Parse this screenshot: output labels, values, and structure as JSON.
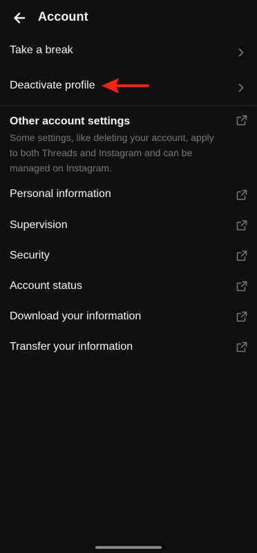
{
  "header": {
    "title": "Account"
  },
  "rows_top": {
    "take_break": "Take a break",
    "deactivate": "Deactivate profile"
  },
  "section": {
    "title": "Other account settings",
    "description": "Some settings, like deleting your account, apply to both Threads and Instagram and can be managed on Instagram."
  },
  "rows_external": {
    "personal_info": "Personal information",
    "supervision": "Supervision",
    "security": "Security",
    "account_status": "Account status",
    "download_info": "Download your information",
    "transfer_info": "Transfer your information"
  },
  "colors": {
    "background": "#101010",
    "text": "#f3f5f7",
    "secondary_text": "#777777",
    "annotation_arrow": "#ff1f0f"
  }
}
